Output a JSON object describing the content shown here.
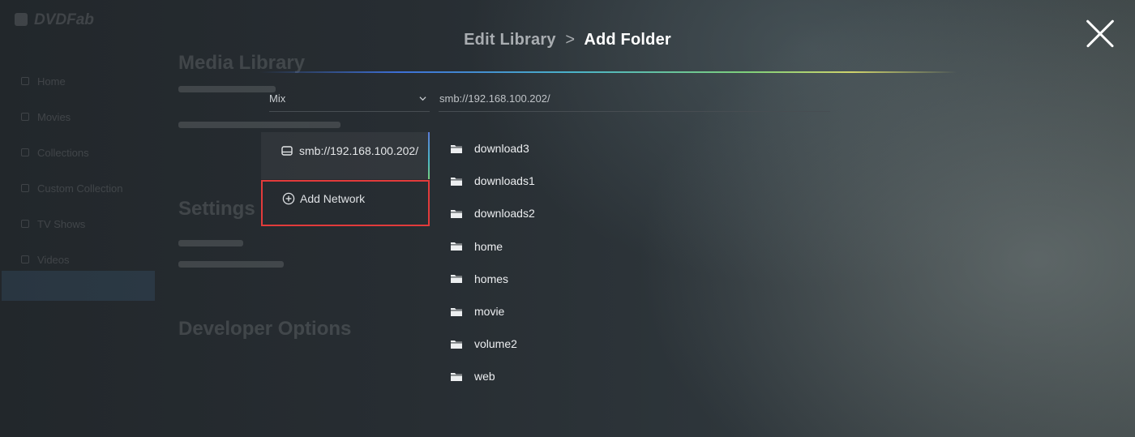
{
  "background": {
    "logo": "DVDFab",
    "nav_items": [
      "Home",
      "Movies",
      "Collections",
      "Custom Collection",
      "TV Shows",
      "Videos"
    ],
    "sections": [
      "Media Library",
      "Settings",
      "Developer Options"
    ]
  },
  "dialog": {
    "breadcrumb_parent": "Edit Library",
    "breadcrumb_separator": ">",
    "title": "Add Folder",
    "close_icon": "close-icon",
    "type_select": {
      "value": "Mix"
    },
    "path_field": {
      "value": "smb://192.168.100.202/"
    },
    "networks": [
      {
        "label": "smb://192.168.100.202/",
        "icon": "drive-icon",
        "selected": true
      }
    ],
    "add_network": {
      "label": "Add Network",
      "icon": "plus-circle-icon",
      "highlight_color": "#e23b3b"
    },
    "folders": [
      "download3",
      "downloads1",
      "downloads2",
      "home",
      "homes",
      "movie",
      "volume2",
      "web"
    ],
    "accent_colors": [
      "#3d6fd6",
      "#4bb3c9",
      "#7fd07a",
      "#cfd36c"
    ]
  }
}
